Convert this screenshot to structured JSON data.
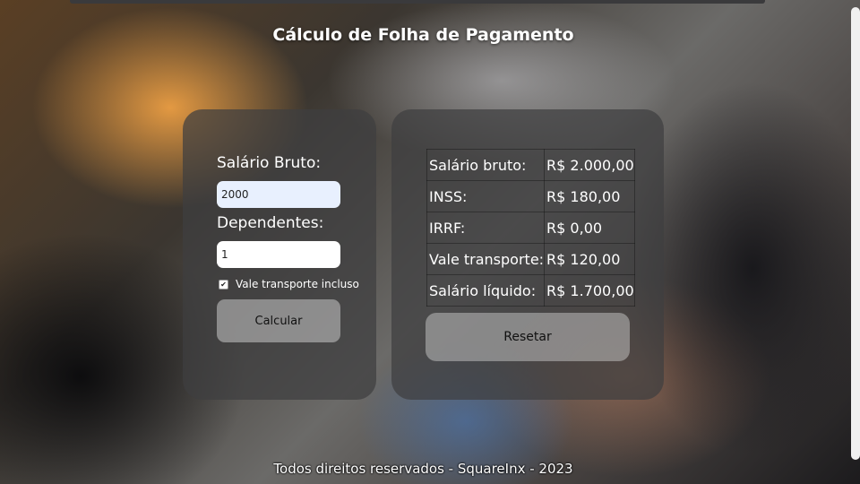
{
  "title": "Cálculo de Folha de Pagamento",
  "form": {
    "salario_label": "Salário Bruto:",
    "salario_value": "2000",
    "dependentes_label": "Dependentes:",
    "dependentes_value": "1",
    "vale_checkbox_label": "Vale transporte incluso",
    "vale_checked": true,
    "calcular_label": "Calcular"
  },
  "results": {
    "rows": [
      {
        "label": "Salário bruto:",
        "value": "R$ 2.000,00"
      },
      {
        "label": "INSS:",
        "value": "R$ 180,00"
      },
      {
        "label": "IRRF:",
        "value": "R$ 0,00"
      },
      {
        "label": "Vale transporte:",
        "value": "R$ 120,00"
      },
      {
        "label": "Salário líquido:",
        "value": "R$ 1.700,00"
      }
    ],
    "resetar_label": "Resetar"
  },
  "footer": "Todos direitos reservados - SquareInx - 2023",
  "colors": {
    "panel": "#3e3e40",
    "input_autofill": "#e8f0fe",
    "text": "#ffffff"
  }
}
